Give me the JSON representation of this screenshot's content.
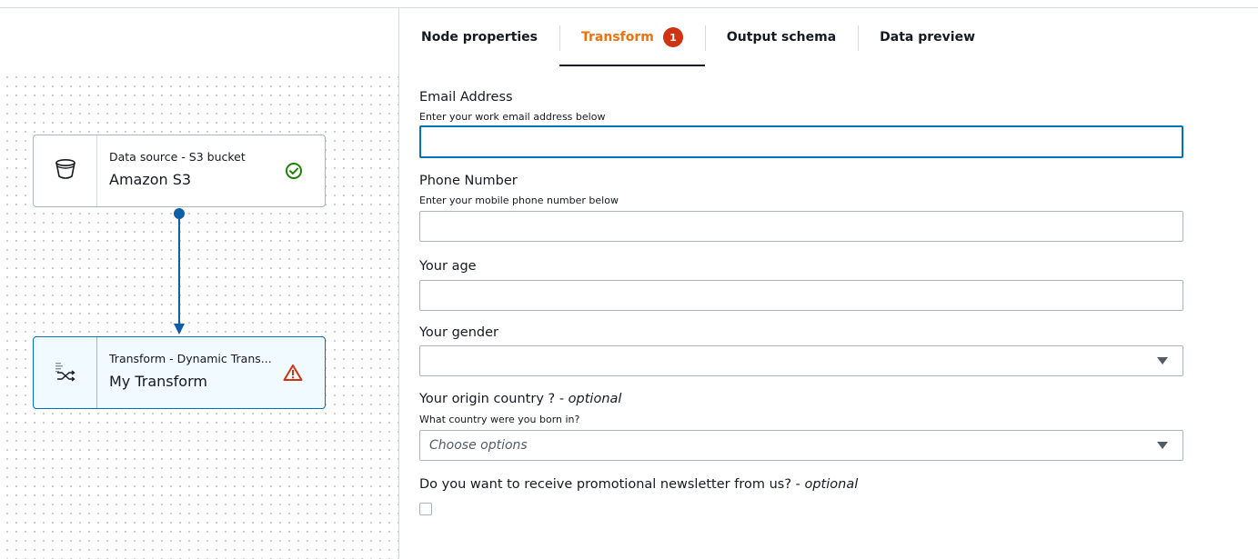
{
  "tabs": [
    {
      "label": "Node properties",
      "active": false
    },
    {
      "label": "Transform",
      "active": true,
      "badge": "1"
    },
    {
      "label": "Output schema",
      "active": false
    },
    {
      "label": "Data preview",
      "active": false
    }
  ],
  "canvas": {
    "nodes": [
      {
        "subtitle": "Data source - S3 bucket",
        "title": "Amazon S3",
        "icon": "bucket-icon",
        "status": "success-check-icon"
      },
      {
        "subtitle": "Transform - Dynamic Trans...",
        "title": "My Transform",
        "icon": "transform-shuffle-icon",
        "status": "warning-triangle-icon"
      }
    ]
  },
  "form": {
    "email": {
      "label": "Email Address",
      "description": "Enter your work email address below",
      "value": ""
    },
    "phone": {
      "label": "Phone Number",
      "description": "Enter your mobile phone number below",
      "value": ""
    },
    "age": {
      "label": "Your age",
      "value": ""
    },
    "gender": {
      "label": "Your gender",
      "selected": ""
    },
    "country": {
      "label": "Your origin country ? - ",
      "optional_text": "optional",
      "description": "What country were you born in?",
      "placeholder": "Choose options"
    },
    "newsletter": {
      "label": "Do you want to receive promotional newsletter from us? - ",
      "optional_text": "optional",
      "checked": false
    }
  },
  "colors": {
    "accent_orange": "#ec7211",
    "badge_red": "#d13212",
    "link_blue": "#0073bb",
    "success_green": "#1d8102",
    "warning_red": "#d13212"
  }
}
